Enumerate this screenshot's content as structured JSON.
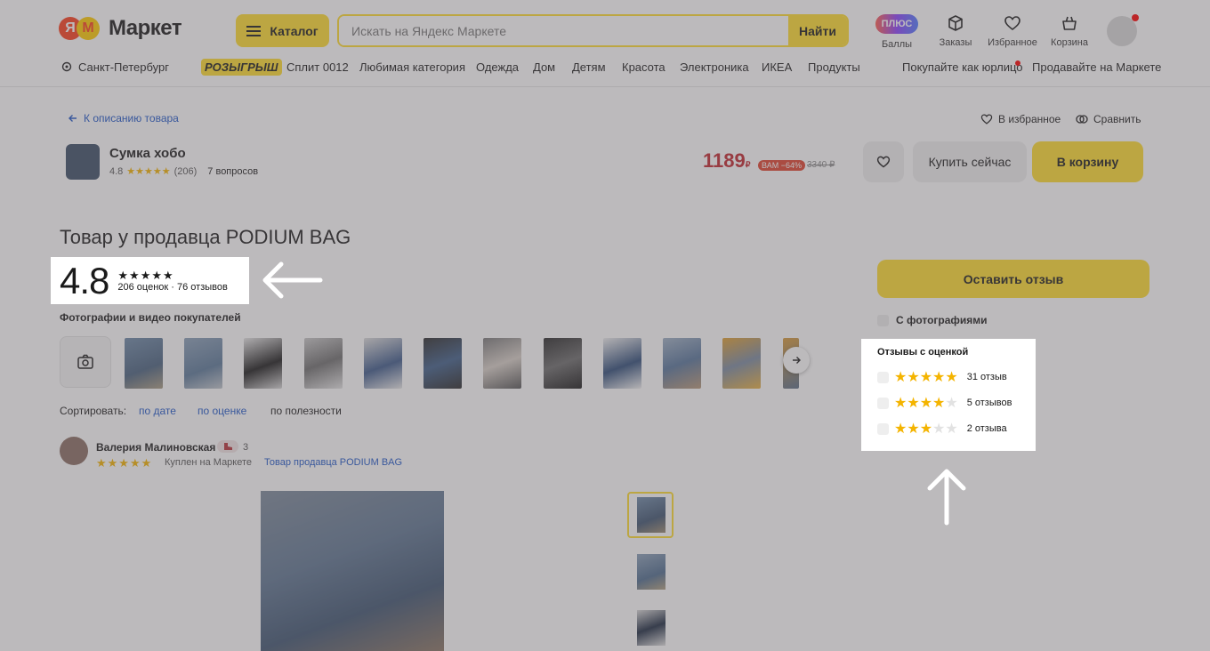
{
  "header": {
    "logo_ya": "Я",
    "logo_m": "М",
    "logo_text": "Маркет",
    "catalog_label": "Каталог",
    "search_placeholder": "Искать на Яндекс Маркете",
    "find_label": "Найти",
    "plus_label": "ПЛЮС",
    "points_label": "Баллы",
    "orders_label": "Заказы",
    "favorites_label": "Избранное",
    "cart_label": "Корзина"
  },
  "nav": {
    "location": "Санкт-Петербург",
    "promo": "РОЗЫГРЫШ",
    "items": [
      "Сплит 0012",
      "Любимая категория",
      "Одежда",
      "Дом",
      "Детям",
      "Красота",
      "Электроника",
      "ИКЕА",
      "Продукты"
    ],
    "business": "Покупайте как юрлицо",
    "sell": "Продавайте на Маркете"
  },
  "product": {
    "back": "К описанию товара",
    "add_fav": "В избранное",
    "compare": "Сравнить",
    "title": "Сумка хобо",
    "rating": "4.8",
    "stars": "★★★★★",
    "reviews_count": "(206)",
    "questions": "7 вопросов",
    "price": "1189",
    "currency": "₽",
    "discount_badge": "ВАМ −64%",
    "old_price": "3340 ₽",
    "buy_now": "Купить сейчас",
    "to_cart": "В корзину"
  },
  "reviews": {
    "page_title": "Товар у продавца PODIUM BAG",
    "big_rating": "4.8",
    "stars": "★★★★★",
    "counts": "206 оценок · 76 отзывов",
    "photos_label": "Фотографии и видео покупателей",
    "sort_label": "Сортировать:",
    "sort_date": "по дате",
    "sort_rating": "по оценке",
    "sort_useful": "по полезности",
    "leave_review": "Оставить отзыв",
    "with_photos": "С фотографиями",
    "filter_title": "Отзывы с оценкой",
    "filters": [
      {
        "stars_on": "★★★★★",
        "stars_off": "",
        "label": "31 отзыв"
      },
      {
        "stars_on": "★★★★",
        "stars_off": "★",
        "label": "5 отзывов"
      },
      {
        "stars_on": "★★★",
        "stars_off": "★★",
        "label": "2 отзыва"
      }
    ]
  },
  "review": {
    "author": "Валерия Малиновская",
    "level": "3",
    "stars": "★★★★★",
    "meta": "Куплен на Маркете",
    "link": "Товар продавца PODIUM BAG"
  },
  "colors": {
    "accent_yellow": "#ffdd2d",
    "price_red": "#c1272d",
    "link_blue": "#1e56c8",
    "star_yellow": "#f4b400"
  }
}
